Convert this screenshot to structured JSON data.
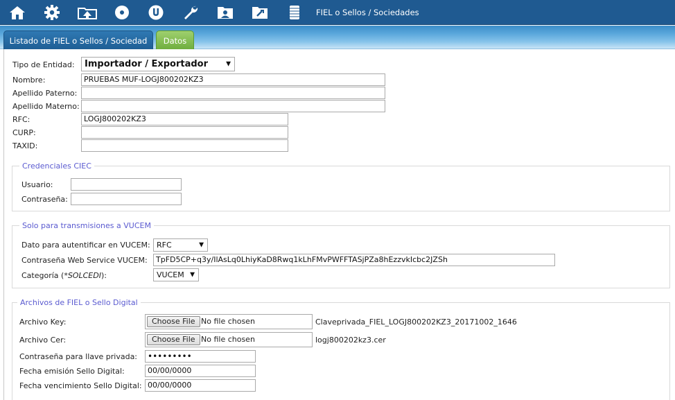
{
  "nav": {
    "icons": [
      "home-icon",
      "gear-icon",
      "upload-folder-icon",
      "disc-icon",
      "u-circle-icon",
      "wrench-icon",
      "user-folder-icon",
      "open-folder-icon",
      "notepad-icon"
    ],
    "breadcrumb": "FIEL o Sellos / Sociedades"
  },
  "tabs": {
    "list": "Listado de FIEL o Sellos / Sociedad",
    "data": "Datos"
  },
  "form": {
    "tipo_label": "Tipo de Entidad:",
    "tipo_value": "Importador / Exportador",
    "nombre_label": "Nombre:",
    "nombre_value": "PRUEBAS MUF-LOGJ800202KZ3",
    "ap_paterno_label": "Apellido Paterno:",
    "ap_paterno_value": "",
    "ap_materno_label": "Apellido Materno:",
    "ap_materno_value": "",
    "rfc_label": "RFC:",
    "rfc_value": "LOGJ800202KZ3",
    "curp_label": "CURP:",
    "curp_value": "",
    "taxid_label": "TAXID:",
    "taxid_value": ""
  },
  "ciec": {
    "legend": "Credenciales CIEC",
    "usuario_label": "Usuario:",
    "usuario_value": "",
    "pass_label": "Contraseña:",
    "pass_value": ""
  },
  "vucem": {
    "legend": "Solo para transmisiones a VUCEM",
    "auth_label": "Dato para autentificar en VUCEM:",
    "auth_value": "RFC",
    "ws_label": "Contraseña Web Service VUCEM:",
    "ws_value": "TpFD5CP+q3y/IlAsLq0LhiyKaD8Rwq1kLhFMvPWFFTASjPZa8hEzzvkIcbc2JZSh",
    "cat_label_a": "Categoría (",
    "cat_label_b": "*SOLCEDI",
    "cat_label_c": "):",
    "cat_value": "VUCEM"
  },
  "archivos": {
    "legend": "Archivos de FIEL o Sello Digital",
    "key_label": "Archivo Key:",
    "key_button": "Choose File",
    "key_status": "No file chosen",
    "key_current": "Claveprivada_FIEL_LOGJ800202KZ3_20171002_1646",
    "cer_label": "Archivo Cer:",
    "cer_button": "Choose File",
    "cer_status": "No file chosen",
    "cer_current": "logj800202kz3.cer",
    "llave_label": "Contraseña para llave privada:",
    "llave_value": "•••••••••",
    "emision_label": "Fecha emisión Sello Digital:",
    "emision_value": "00/00/0000",
    "venc_label": "Fecha vencimiento Sello Digital:",
    "venc_value": "00/00/0000"
  }
}
